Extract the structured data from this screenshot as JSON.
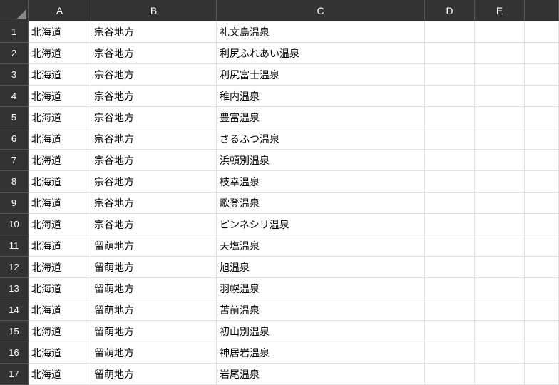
{
  "columns": [
    "A",
    "B",
    "C",
    "D",
    "E",
    ""
  ],
  "rows": [
    {
      "n": "1",
      "a": "北海道",
      "b": "宗谷地方",
      "c": "礼文島温泉",
      "d": "",
      "e": ""
    },
    {
      "n": "2",
      "a": "北海道",
      "b": "宗谷地方",
      "c": "利尻ふれあい温泉",
      "d": "",
      "e": ""
    },
    {
      "n": "3",
      "a": "北海道",
      "b": "宗谷地方",
      "c": "利尻富士温泉",
      "d": "",
      "e": ""
    },
    {
      "n": "4",
      "a": "北海道",
      "b": "宗谷地方",
      "c": "稚内温泉",
      "d": "",
      "e": ""
    },
    {
      "n": "5",
      "a": "北海道",
      "b": "宗谷地方",
      "c": "豊富温泉",
      "d": "",
      "e": ""
    },
    {
      "n": "6",
      "a": "北海道",
      "b": "宗谷地方",
      "c": "さるふつ温泉",
      "d": "",
      "e": ""
    },
    {
      "n": "7",
      "a": "北海道",
      "b": "宗谷地方",
      "c": "浜頓別温泉",
      "d": "",
      "e": ""
    },
    {
      "n": "8",
      "a": "北海道",
      "b": "宗谷地方",
      "c": "枝幸温泉",
      "d": "",
      "e": ""
    },
    {
      "n": "9",
      "a": "北海道",
      "b": "宗谷地方",
      "c": "歌登温泉",
      "d": "",
      "e": ""
    },
    {
      "n": "10",
      "a": "北海道",
      "b": "宗谷地方",
      "c": "ピンネシリ温泉",
      "d": "",
      "e": ""
    },
    {
      "n": "11",
      "a": "北海道",
      "b": "留萌地方",
      "c": "天塩温泉",
      "d": "",
      "e": ""
    },
    {
      "n": "12",
      "a": "北海道",
      "b": "留萌地方",
      "c": "旭温泉",
      "d": "",
      "e": ""
    },
    {
      "n": "13",
      "a": "北海道",
      "b": "留萌地方",
      "c": "羽幌温泉",
      "d": "",
      "e": ""
    },
    {
      "n": "14",
      "a": "北海道",
      "b": "留萌地方",
      "c": "苫前温泉",
      "d": "",
      "e": ""
    },
    {
      "n": "15",
      "a": "北海道",
      "b": "留萌地方",
      "c": "初山別温泉",
      "d": "",
      "e": ""
    },
    {
      "n": "16",
      "a": "北海道",
      "b": "留萌地方",
      "c": "神居岩温泉",
      "d": "",
      "e": ""
    },
    {
      "n": "17",
      "a": "北海道",
      "b": "留萌地方",
      "c": "岩尾温泉",
      "d": "",
      "e": ""
    }
  ]
}
